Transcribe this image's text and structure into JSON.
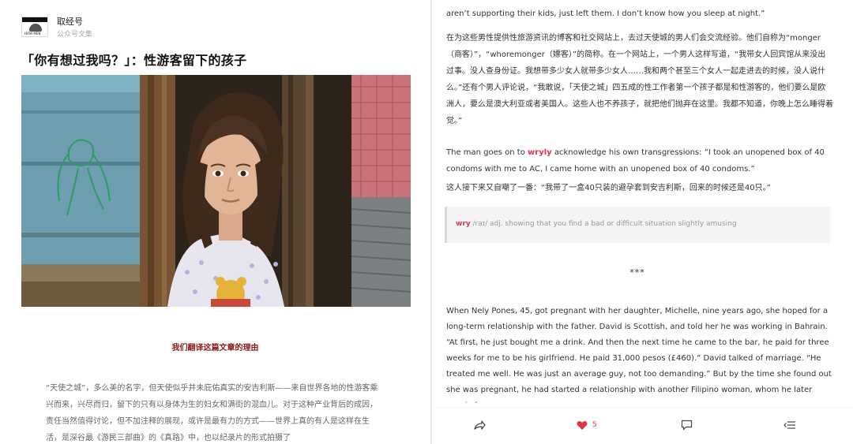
{
  "left": {
    "account_logo_caption": "HOW MEN",
    "account_name": "取经号",
    "account_sub": "公众号文集",
    "article_title": "「你有想过我吗？」：性游客留下的孩子",
    "reason_heading": "我们翻译这篇文章的理由",
    "intro_text": "“天使之城”，多么美的名字，但天使似乎并未庇佑真实的安吉利斯——来自世界各地的性游客乘兴而来，兴尽而归，留下的只有以身体为生的妇女和满街的混血儿。对于这种产业背后的成因，责任当然值得讨论，但不加注释的展现，或许是最有力的方式——世界上真的有人是这样在生活，是深谷最《游民三部曲》的《真路》中，也以纪录片的形式拍摄了"
  },
  "right": {
    "top_line": "aren’t supporting their kids, just left them. I don’t know how you sleep at night.”",
    "zh_para1": "在为这些男性提供性旅游资讯的博客和社交网站上，去过天使城的男人们会交流经验。他们自称为“monger（商客）”，“whoremonger（嫖客）”的简称。在一个网站上，一个男人这样写道，“我带女人回宾馆从来没出过事。没人查身份证。我想带多少女人就带多少女人……我和两个甚至三个女人一起走进去的时候，没人说什么。”还有个男人评论说，“我敢说，「天使之城」四五成的性工作者第一个孩子都是和性游客的，他们要么是欧洲人，要么是澳大利亚或者美国人。这些人也不养孩子，就把他们抛弃在这里。我都不知道，你晚上怎么睡得着觉。”",
    "en_para2_before": "The man goes on to ",
    "en_para2_highlight": "wryly",
    "en_para2_after": " acknowledge his own transgressions: “I took an unopened box of 40 condoms with me to AC, I came home with an unopened box of 40 condoms.”",
    "zh_para2": "这人接下来又自嘲了一番：“我带了一盒40只装的避孕套到安吉利斯，回来的时候还是40只。”",
    "vocab_word": "wry",
    "vocab_def": " /raɪ/ adj. showing that you find a bad or difficult situation slightly amusing",
    "separator": "***",
    "en_para3": "When Nely Pones, 45, got pregnant with her daughter, Michelle, nine years ago, she hoped for a long-term relationship with the father. David is Scottish, and told her he was working in Bahrain. “At first, he just bought me a drink. And then the next time he came to the bar, he paid for three weeks for me to be his girlfriend. He paid 31,000 pesos (£460).” David talked of marriage. “He treated me well. He was just an average guy, not too demanding.” But by the time she found out she was pregnant, he had started a relationship with another Filipino woman, whom he later married.",
    "like_count": "5"
  },
  "icons": {
    "share": "share-icon",
    "like": "heart-icon",
    "comment": "comment-icon",
    "menu": "list-menu-icon"
  },
  "colors": {
    "accent": "#d8394a",
    "reason_heading": "#8b1c1c",
    "vocab_bg": "#f4f4f4"
  }
}
